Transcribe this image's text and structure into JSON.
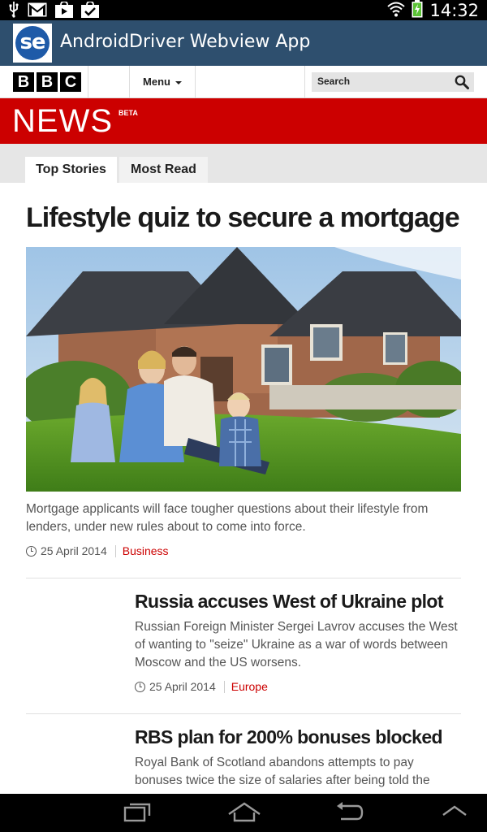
{
  "status_bar": {
    "time": "14:32",
    "left_icons": [
      "usb-icon",
      "gmail-icon",
      "play-store-icon",
      "download-done-icon"
    ],
    "right_icons": [
      "wifi-icon",
      "battery-charging-icon"
    ]
  },
  "app_bar": {
    "logo_text": "se",
    "title": "AndroidDriver Webview App"
  },
  "masthead": {
    "logo_letters": [
      "B",
      "B",
      "C"
    ],
    "menu_label": "Menu",
    "search_placeholder": "Search"
  },
  "banner": {
    "title": "NEWS",
    "badge": "BETA"
  },
  "tabs": [
    {
      "label": "Top Stories",
      "active": true
    },
    {
      "label": "Most Read",
      "active": false
    }
  ],
  "lead_story": {
    "title": "Lifestyle quiz to secure a mortgage",
    "summary": "Mortgage applicants will face tougher questions about their lifestyle from lenders, under new rules about to come into force.",
    "date": "25 April 2014",
    "category": "Business"
  },
  "stories": [
    {
      "title": "Russia accuses West of Ukraine plot",
      "summary": "Russian Foreign Minister Sergei Lavrov accuses the West of wanting to \"seize\" Ukraine as a war of words between Moscow and the US worsens.",
      "date": "25 April 2014",
      "category": "Europe"
    },
    {
      "title": "RBS plan for 200% bonuses blocked",
      "summary": "Royal Bank of Scotland abandons attempts to pay bonuses twice the size of salaries after being told the",
      "date": "",
      "category": ""
    }
  ],
  "nav_bar": {
    "buttons": [
      "recent-apps-icon",
      "home-icon",
      "back-icon",
      "collapse-up-icon"
    ]
  },
  "colors": {
    "app_bar": "#2e4f6e",
    "bbc_red": "#cc0000",
    "tab_bar": "#e6e6e6"
  }
}
